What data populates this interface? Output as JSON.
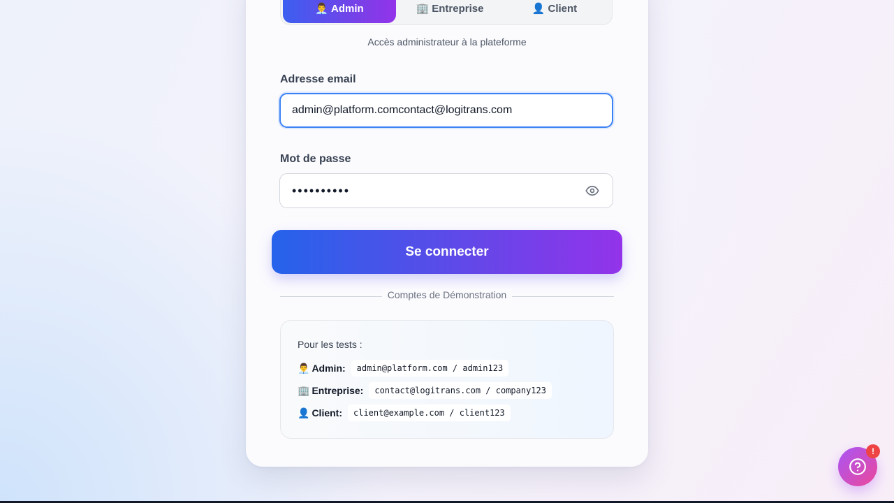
{
  "tabs": [
    {
      "icon": "👨‍💼",
      "label": "Admin",
      "active": true
    },
    {
      "icon": "🏢",
      "label": "Entreprise",
      "active": false
    },
    {
      "icon": "👤",
      "label": "Client",
      "active": false
    }
  ],
  "subtitle": "Accès administrateur à la plateforme",
  "email": {
    "label": "Adresse email",
    "value": "admin@platform.comcontact@logitrans.com"
  },
  "password": {
    "label": "Mot de passe",
    "masked_value": "••••••••••"
  },
  "login_button": "Se connecter",
  "divider_text": "Comptes de Démonstration",
  "demo": {
    "title": "Pour les tests :",
    "accounts": [
      {
        "icon": "👨‍💼",
        "role": "Admin:",
        "credentials": "admin@platform.com / admin123"
      },
      {
        "icon": "🏢",
        "role": "Entreprise:",
        "credentials": "contact@logitrans.com / company123"
      },
      {
        "icon": "👤",
        "role": "Client:",
        "credentials": "client@example.com / client123"
      }
    ]
  },
  "help": {
    "icon": "question-circle-icon",
    "badge": "!"
  },
  "colors": {
    "accent_start": "#2563eb",
    "accent_end": "#9333ea",
    "focus_border": "#3b82f6",
    "badge": "#ef4444"
  }
}
